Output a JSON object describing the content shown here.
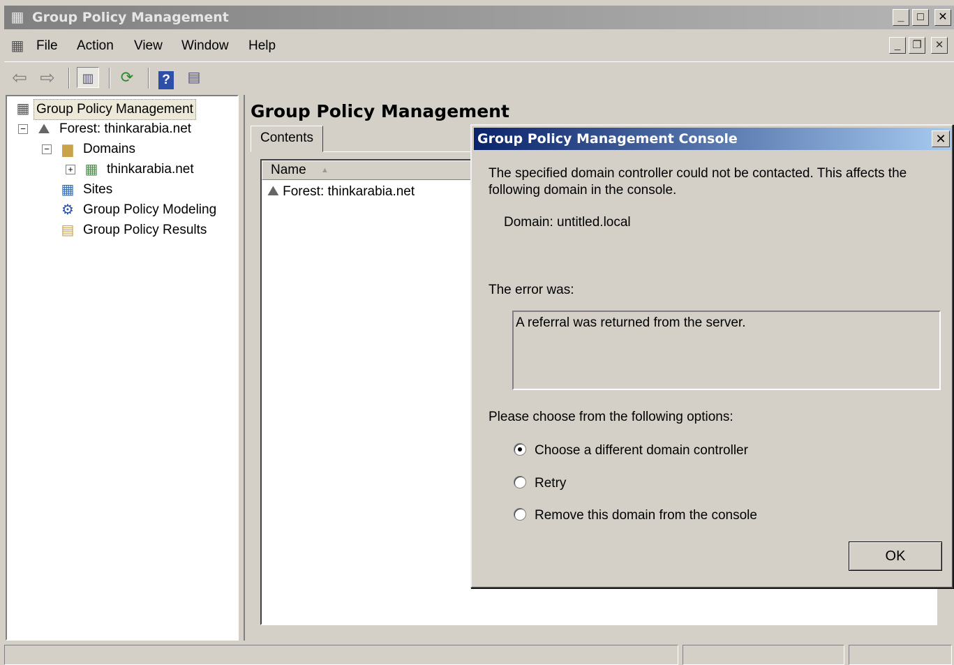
{
  "window": {
    "title": "Group Policy Management",
    "controls": {
      "minimize": "_",
      "maximize": "□",
      "close": "✕"
    }
  },
  "menubar": {
    "items": [
      "File",
      "Action",
      "View",
      "Window",
      "Help"
    ],
    "mdi_controls": {
      "minimize": "_",
      "restore": "❐",
      "close": "✕"
    }
  },
  "toolbar": {
    "icons": [
      "back-arrow-icon",
      "forward-arrow-icon",
      "show-hide-tree-icon",
      "refresh-icon",
      "help-icon",
      "properties-view-icon"
    ]
  },
  "tree": {
    "root": "Group Policy Management",
    "forest": "Forest: thinkarabia.net",
    "domains": "Domains",
    "domain_node": "thinkarabia.net",
    "sites": "Sites",
    "modeling": "Group Policy Modeling",
    "results": "Group Policy Results",
    "expander_minus": "−",
    "expander_plus": "+"
  },
  "right_pane": {
    "title": "Group Policy Management",
    "tab": "Contents",
    "column_name": "Name",
    "sort_indicator": "▲",
    "row": "Forest: thinkarabia.net"
  },
  "dialog": {
    "title": "Group Policy Management Console",
    "close": "✕",
    "message_line1": "The specified domain controller could not be contacted. This affects the",
    "message_line2": "following domain in the console.",
    "domain_line": "Domain: untitled.local",
    "error_label": "The error was:",
    "error_text": "A referral was returned from the server.",
    "options_label": "Please choose from the following options:",
    "options": [
      {
        "label": "Choose a different domain controller",
        "selected": true
      },
      {
        "label": "Retry",
        "selected": false
      },
      {
        "label": "Remove this domain from the console",
        "selected": false
      }
    ],
    "ok_label": "OK"
  },
  "colors": {
    "dialog_title_start": "#0a246a",
    "dialog_title_end": "#a6caf0",
    "window_title_inactive": "#808080",
    "face": "#d4d0c8"
  }
}
